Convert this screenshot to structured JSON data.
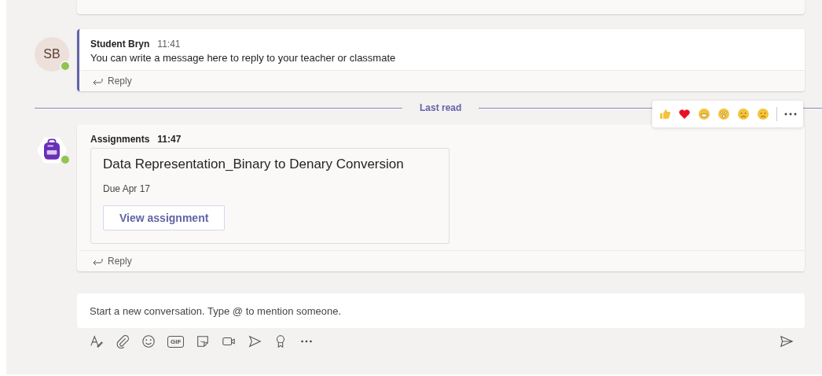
{
  "messages": [
    {
      "kind": "person",
      "avatar": "SB",
      "online": true,
      "highlighted": true,
      "author": "Student Bryn",
      "time": "11:41",
      "text": "You can write a message here to reply to your teacher or classmate",
      "reply": "Reply",
      "divider": {
        "label": "Last read"
      }
    },
    {
      "kind": "app",
      "online": true,
      "highlighted": false,
      "author": "Assignments",
      "time": "11:47",
      "card": {
        "title": "Data Representation_Binary to Denary Conversion",
        "due": "Due Apr 17",
        "button": "View assignment"
      },
      "reply": "Reply",
      "reactions": [
        {
          "kind": "like"
        },
        {
          "kind": "heart"
        },
        {
          "kind": "laugh"
        },
        {
          "kind": "surprised"
        },
        {
          "kind": "sad"
        },
        {
          "kind": "angry"
        }
      ]
    }
  ],
  "compose": {
    "placeholder": "Start a new conversation. Type @ to mention someone.",
    "tools": [
      {
        "kind": "format"
      },
      {
        "kind": "attach"
      },
      {
        "kind": "emoji"
      },
      {
        "kind": "gif",
        "label": "GIF"
      },
      {
        "kind": "sticker"
      },
      {
        "kind": "meet"
      },
      {
        "kind": "stream"
      },
      {
        "kind": "praise"
      },
      {
        "kind": "more"
      }
    ]
  }
}
